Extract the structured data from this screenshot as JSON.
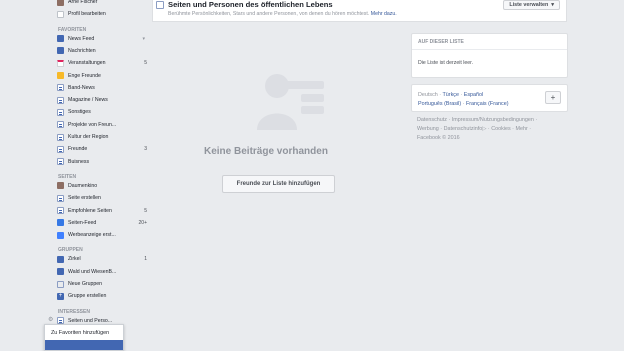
{
  "sidebar": {
    "top_items": [
      {
        "label": "Arne Fischer",
        "icon": "avatar-icon"
      },
      {
        "label": "Profil bearbeiten",
        "icon": "edit-icon"
      }
    ],
    "favorites_heading": "FAVORITEN",
    "favorites": [
      {
        "label": "News Feed",
        "count": "",
        "icon": "feed-icon"
      },
      {
        "label": "Nachrichten",
        "count": "",
        "icon": "messages-icon"
      },
      {
        "label": "Veranstaltungen",
        "count": "5",
        "icon": "calendar-icon"
      },
      {
        "label": "Enge Freunde",
        "count": "",
        "icon": "star-icon"
      },
      {
        "label": "Band-News",
        "count": "",
        "icon": "list-icon"
      },
      {
        "label": "Magazine / News",
        "count": "",
        "icon": "list-icon"
      },
      {
        "label": "Sonstiges",
        "count": "",
        "icon": "list-icon"
      },
      {
        "label": "Projekte von Freun...",
        "count": "",
        "icon": "list-icon"
      },
      {
        "label": "Kultur der Region",
        "count": "",
        "icon": "list-icon"
      },
      {
        "label": "Freunde",
        "count": "3",
        "icon": "list-icon"
      },
      {
        "label": "Buisness",
        "count": "",
        "icon": "list-icon"
      }
    ],
    "pages_heading": "SEITEN",
    "pages": [
      {
        "label": "Daumenkino",
        "count": "",
        "icon": "page-avatar-icon"
      },
      {
        "label": "Seite erstellen",
        "count": "",
        "icon": "create-page-icon"
      },
      {
        "label": "Empfohlene Seiten",
        "count": "5",
        "icon": "list-icon"
      },
      {
        "label": "Seiten-Feed",
        "count": "20+",
        "icon": "pages-feed-icon"
      },
      {
        "label": "Werbeanzeige erst...",
        "count": "",
        "icon": "chart-icon"
      }
    ],
    "groups_heading": "GRUPPEN",
    "groups": [
      {
        "label": "Zirkel",
        "count": "1",
        "icon": "group-icon"
      },
      {
        "label": "Wald und WiesenB...",
        "count": "",
        "icon": "group-icon"
      },
      {
        "label": "Neue Gruppen",
        "count": "",
        "icon": "people-icon"
      },
      {
        "label": "Gruppe erstellen",
        "count": "",
        "icon": "plus-icon"
      }
    ],
    "interests_heading": "INTERESSEN",
    "interests": [
      {
        "label": "Seiten und Perso...",
        "count": "",
        "icon": "list-icon"
      }
    ],
    "context_menu": {
      "items": [
        "Zu Favoriten hinzufügen",
        ""
      ]
    }
  },
  "header": {
    "title": "Seiten und Personen des öffentlichen Lebens",
    "subtitle": "Berühmte Persönlichkeiten, Stars und andere Personen, von denen du hören möchtest.",
    "more_link": "Mehr dazu.",
    "manage_button": "Liste verwalten"
  },
  "main": {
    "empty_text": "Keine Beiträge vorhanden",
    "add_friends_button": "Freunde zur Liste hinzufügen"
  },
  "about_card": {
    "heading": "AUF DIESER LISTE",
    "body": "Die Liste ist derzeit leer."
  },
  "languages": {
    "current": "Deutsch",
    "links": [
      "Türkçe",
      "Español",
      "Português (Brasil)",
      "Français (France)"
    ],
    "add_label": "+"
  },
  "footer": {
    "links": [
      "Datenschutz",
      "Impressum/Nutzungsbedingungen",
      "Werbung",
      "Datenschutzinfo",
      "Cookies",
      "Mehr"
    ],
    "copyright": "Facebook © 2016"
  },
  "colors": {
    "background": "#e9ebee",
    "brand_blue": "#4267b2",
    "link": "#365899",
    "muted": "#90949c"
  }
}
